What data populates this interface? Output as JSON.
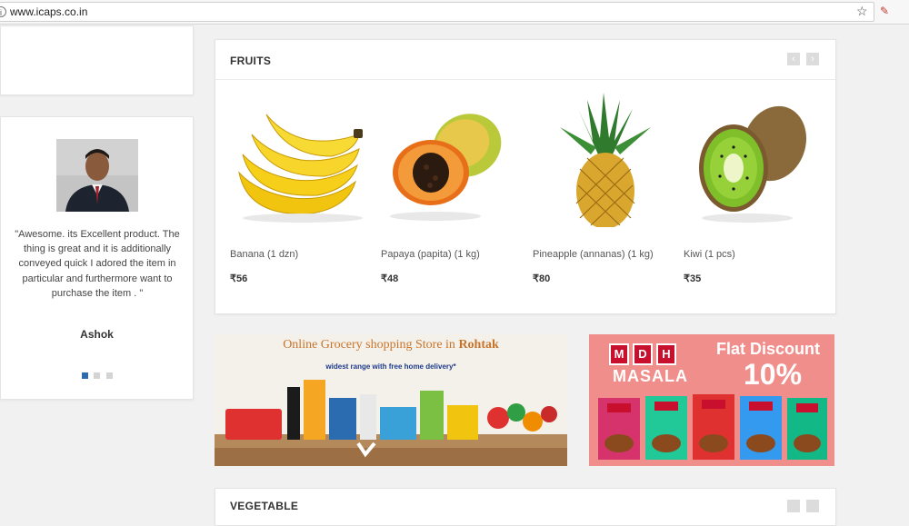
{
  "browser": {
    "url": "www.icaps.co.in"
  },
  "testimonial": {
    "quote": "\"Awesome. its Excellent product. The thing is great and it is additionally conveyed quick I adored the item in particular and furthermore want to purchase the item . \"",
    "author": "Ashok"
  },
  "fruits": {
    "title": "FRUITS",
    "nav": {
      "prev": "‹",
      "next": "›"
    },
    "products": [
      {
        "name": "Banana (1 dzn)",
        "price": "₹56",
        "icon": "banana-image"
      },
      {
        "name": "Papaya (papita) (1 kg)",
        "price": "₹48",
        "icon": "papaya-image"
      },
      {
        "name": "Pineapple (annanas) (1 kg)",
        "price": "₹80",
        "icon": "pineapple-image"
      },
      {
        "name": "Kiwi (1 pcs)",
        "price": "₹35",
        "icon": "kiwi-image"
      }
    ]
  },
  "banners": {
    "grocery": {
      "title_prefix": "Online Grocery shopping Store in",
      "title_city": "Rohtak",
      "subtitle": "widest range with free home delivery*"
    },
    "mdh": {
      "logo_letters": [
        "M",
        "D",
        "H"
      ],
      "masala": "MASALA",
      "flat_discount": "Flat Discount",
      "percent": "10%"
    }
  },
  "vegetable": {
    "title": "VEGETABLE"
  },
  "colors": {
    "accent_blue": "#2b6cb0",
    "mdh_red": "#c8102e",
    "mdh_bg": "#f08e8c",
    "grocery_title": "#c8752c"
  }
}
